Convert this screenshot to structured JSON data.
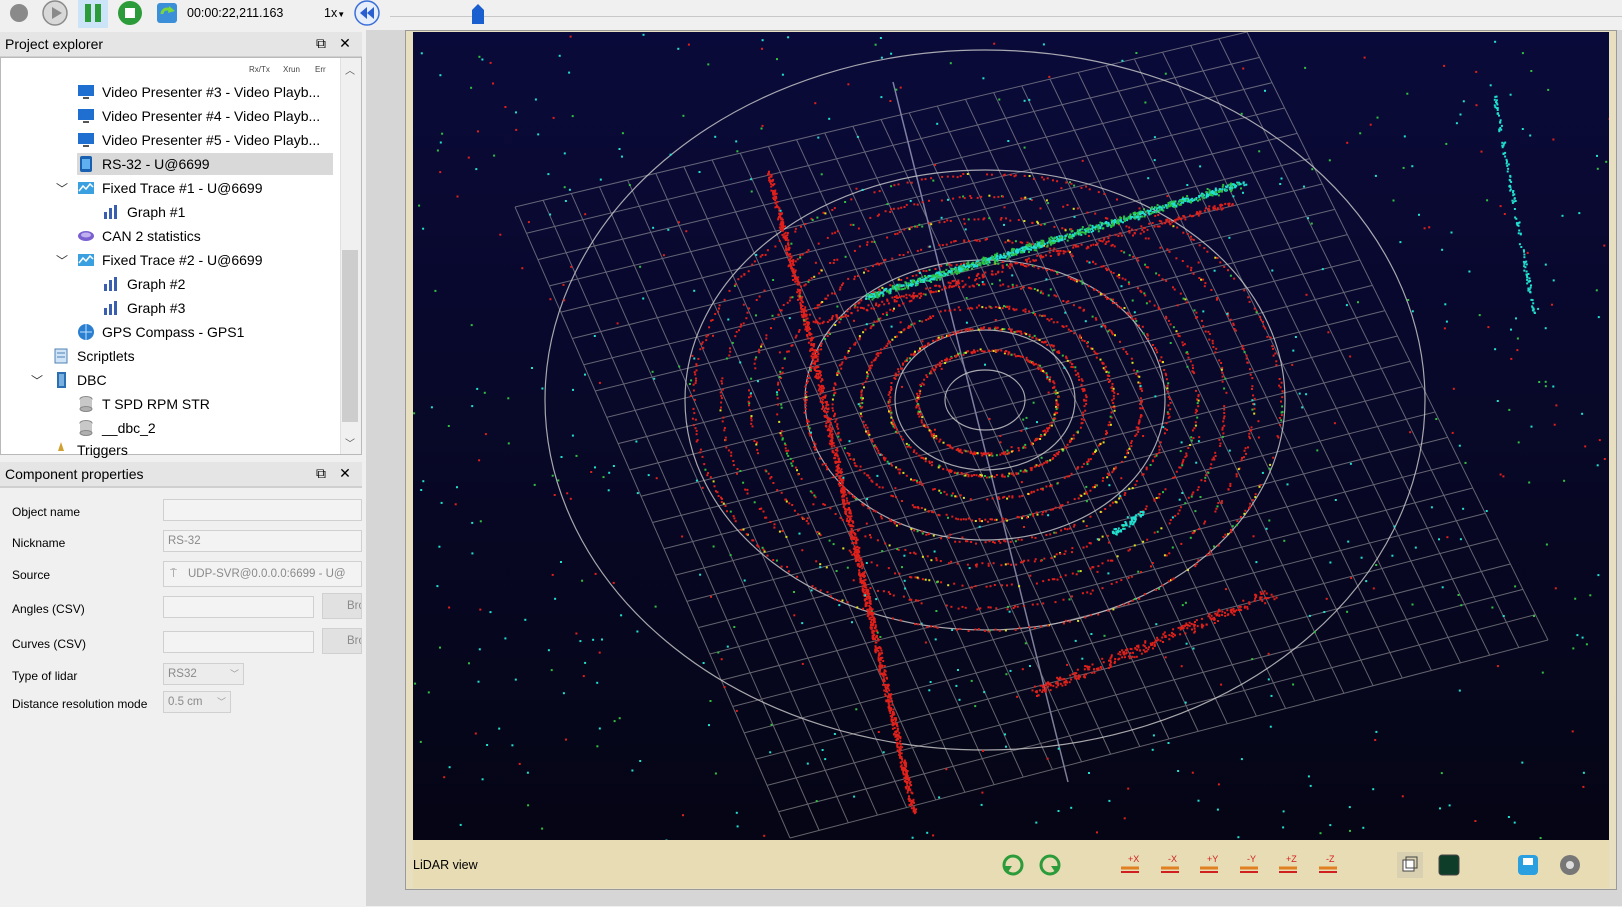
{
  "toolbar": {
    "timecode": "00:00:22,211.163",
    "speed": "1x"
  },
  "project_explorer": {
    "title": "Project explorer",
    "columns": [
      "Rx/Tx",
      "Xrun",
      "Err"
    ],
    "items": [
      {
        "label": "Video Presenter #3 - Video Playb...",
        "icon": "monitor-icon"
      },
      {
        "label": "Video Presenter #4 - Video Playb...",
        "icon": "monitor-icon"
      },
      {
        "label": "Video Presenter #5 - Video Playb...",
        "icon": "monitor-icon"
      },
      {
        "label": "RS-32 - U@6699",
        "icon": "lidar-icon",
        "selected": true
      },
      {
        "label": "Fixed Trace #1 - U@6699",
        "icon": "trace-icon"
      },
      {
        "label": "Graph #1",
        "icon": "graph-icon"
      },
      {
        "label": "CAN 2 statistics",
        "icon": "can-icon"
      },
      {
        "label": "Fixed Trace #2 - U@6699",
        "icon": "trace-icon"
      },
      {
        "label": "Graph #2",
        "icon": "graph-icon"
      },
      {
        "label": "Graph #3",
        "icon": "graph-icon"
      },
      {
        "label": "GPS Compass - GPS1",
        "icon": "globe-icon"
      },
      {
        "label": "Scriptlets",
        "icon": "script-icon"
      },
      {
        "label": "DBC",
        "icon": "dbc-icon"
      },
      {
        "label": "T SPD RPM STR",
        "icon": "database-icon"
      },
      {
        "label": "__dbc_2",
        "icon": "database-icon"
      },
      {
        "label": "Triggers",
        "icon": "trigger-icon"
      }
    ]
  },
  "component_properties": {
    "title": "Component properties",
    "object_name_label": "Object name",
    "object_name_value": "",
    "nickname_label": "Nickname",
    "nickname_value": "RS-32",
    "source_label": "Source",
    "source_value": "UDP-SVR@0.0.0.0:6699 - U@",
    "angles_label": "Angles (CSV)",
    "angles_value": "",
    "angles_browse": "Bro",
    "curves_label": "Curves (CSV)",
    "curves_value": "",
    "curves_browse": "Bro",
    "type_label": "Type of lidar",
    "type_value": "RS32",
    "distres_label": "Distance resolution mode",
    "distres_value": "0.5 cm"
  },
  "lidar_view": {
    "label": "LiDAR view",
    "icons": [
      "rotate-left-icon",
      "rotate-right-icon",
      "plus-x-icon",
      "minus-x-icon",
      "plus-y-icon",
      "minus-y-icon",
      "plus-z-icon",
      "minus-z-icon",
      "cube-icon",
      "screen-icon",
      "save-icon",
      "settings-icon"
    ],
    "icon_labels": [
      "+X",
      "-X",
      "+Y",
      "-Y",
      "+Z",
      "-Z"
    ]
  },
  "colors": {
    "lidar_background_top": "#0a0a3a",
    "lidar_background_bottom": "#050515",
    "grid": "#b0b0b0",
    "points_red": "#e0201a",
    "points_cyan": "#20e0d0",
    "points_green": "#30c040",
    "points_yellow": "#e0e020"
  }
}
